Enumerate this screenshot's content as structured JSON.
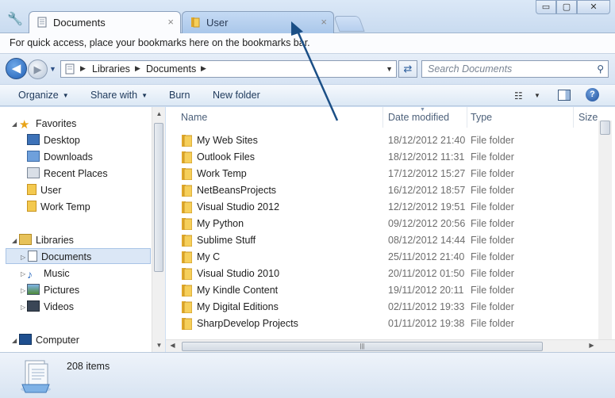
{
  "tabs": [
    {
      "label": "Documents",
      "active": true,
      "close": "×"
    },
    {
      "label": "User",
      "active": false,
      "close": "×"
    }
  ],
  "window_buttons": {
    "minimize": "▭",
    "maximize": "▢",
    "close": "✕"
  },
  "bookmarks_bar": {
    "hint": "For quick access, place your bookmarks here on the bookmarks bar."
  },
  "address": {
    "crumbs": [
      "Libraries",
      "Documents"
    ],
    "search_placeholder": "Search Documents"
  },
  "toolbar": {
    "organize": "Organize",
    "share_with": "Share with",
    "burn": "Burn",
    "new_folder": "New folder"
  },
  "navigation": {
    "favorites": {
      "label": "Favorites",
      "items": [
        "Desktop",
        "Downloads",
        "Recent Places",
        "User",
        "Work Temp"
      ]
    },
    "libraries": {
      "label": "Libraries",
      "items": [
        "Documents",
        "Music",
        "Pictures",
        "Videos"
      ],
      "selected": "Documents"
    },
    "computer": {
      "label": "Computer"
    }
  },
  "columns": {
    "name": "Name",
    "date": "Date modified",
    "type": "Type",
    "size": "Size"
  },
  "files": [
    {
      "name": "My Web Sites",
      "date": "18/12/2012 21:40",
      "type": "File folder"
    },
    {
      "name": "Outlook Files",
      "date": "18/12/2012 11:31",
      "type": "File folder"
    },
    {
      "name": "Work Temp",
      "date": "17/12/2012 15:27",
      "type": "File folder"
    },
    {
      "name": "NetBeansProjects",
      "date": "16/12/2012 18:57",
      "type": "File folder"
    },
    {
      "name": "Visual Studio 2012",
      "date": "12/12/2012 19:51",
      "type": "File folder"
    },
    {
      "name": "My Python",
      "date": "09/12/2012 20:56",
      "type": "File folder"
    },
    {
      "name": "Sublime Stuff",
      "date": "08/12/2012 14:44",
      "type": "File folder"
    },
    {
      "name": "My C",
      "date": "25/11/2012 21:40",
      "type": "File folder"
    },
    {
      "name": "Visual Studio 2010",
      "date": "20/11/2012 01:50",
      "type": "File folder"
    },
    {
      "name": "My Kindle Content",
      "date": "19/11/2012 20:11",
      "type": "File folder"
    },
    {
      "name": "My Digital Editions",
      "date": "02/11/2012 19:33",
      "type": "File folder"
    },
    {
      "name": "SharpDevelop Projects",
      "date": "01/11/2012 19:38",
      "type": "File folder"
    }
  ],
  "status": {
    "item_count": "208 items"
  },
  "colors": {
    "accent": "#1f5fb5",
    "selection": "#dbe7f6",
    "arrow": "#1b4f86"
  }
}
